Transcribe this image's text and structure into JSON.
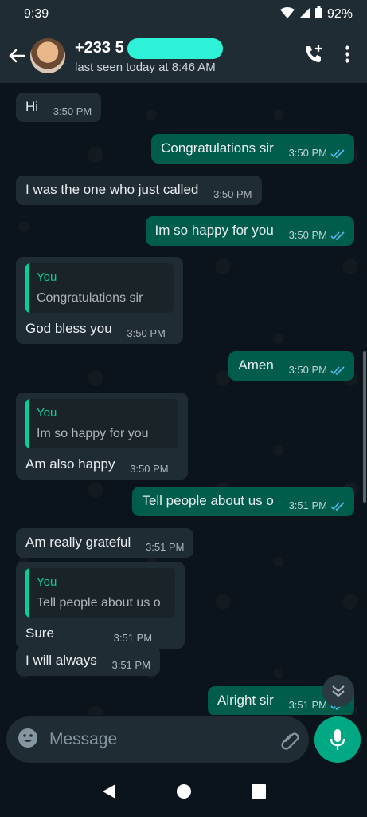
{
  "status_bar": {
    "time": "9:39",
    "battery": "92%"
  },
  "header": {
    "contact_name": "+233 5",
    "last_seen": "last seen today at 8:46 AM"
  },
  "messages": [
    {
      "text": "Hi",
      "time": "3:50 PM"
    },
    {
      "text": "Congratulations sir",
      "time": "3:50 PM"
    },
    {
      "text": "I was the one who just called",
      "time": "3:50 PM"
    },
    {
      "text": "Im so happy for you",
      "time": "3:50 PM"
    },
    {
      "quote_author": "You",
      "quote_text": "Congratulations sir",
      "text": "God bless you",
      "time": "3:50 PM"
    },
    {
      "text": "Amen",
      "time": "3:50 PM"
    },
    {
      "quote_author": "You",
      "quote_text": "Im so happy for you",
      "text": "Am also happy",
      "time": "3:50 PM"
    },
    {
      "text": "Tell people about us o",
      "time": "3:51 PM"
    },
    {
      "text": "Am really grateful",
      "time": "3:51 PM"
    },
    {
      "quote_author": "You",
      "quote_text": "Tell people about us o",
      "text": "Sure",
      "time": "3:51 PM"
    },
    {
      "text": "I will always",
      "time": "3:51 PM"
    },
    {
      "text": "Alright sir",
      "time": "3:51 PM"
    }
  ],
  "composer": {
    "placeholder": "Message"
  },
  "colors": {
    "accent": "#00a884",
    "outgoing": "#005c4b",
    "incoming": "#202c33",
    "read_tick": "#53bdeb"
  },
  "icons": [
    "back-arrow-icon",
    "add-call-icon",
    "more-vert-icon",
    "emoji-icon",
    "attach-icon",
    "camera-icon",
    "mic-icon",
    "scroll-down-icon",
    "nav-back-icon",
    "nav-home-icon",
    "nav-recents-icon"
  ]
}
